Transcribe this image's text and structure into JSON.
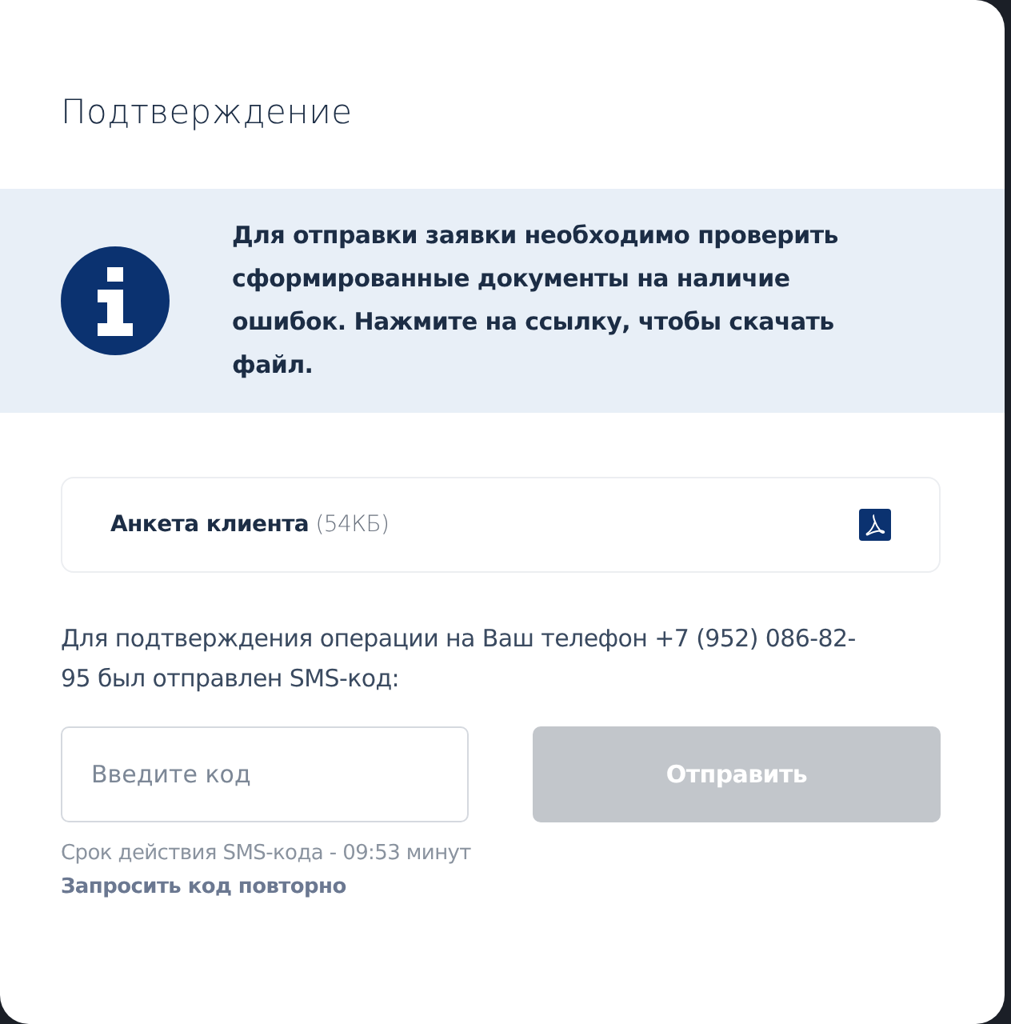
{
  "dialog": {
    "title": "Подтверждение"
  },
  "notice": {
    "text": "Для отправки заявки необходимо проверить сформированные документы на наличие ошибок. Нажмите на ссылку, чтобы скачать файл."
  },
  "files": [
    {
      "name": "Анкета клиента",
      "size": "(54КБ)"
    }
  ],
  "sms_message": "Для подтверждения операции на Ваш телефон +7 (952) 086-82-95 был отправлен SMS-код:",
  "code_field": {
    "placeholder": "Введите код"
  },
  "submit_button": {
    "label": "Отправить",
    "disabled": true
  },
  "expiry": "Срок действия SMS-кода - 09:53 минут",
  "resend_link": "Запросить код повторно"
}
